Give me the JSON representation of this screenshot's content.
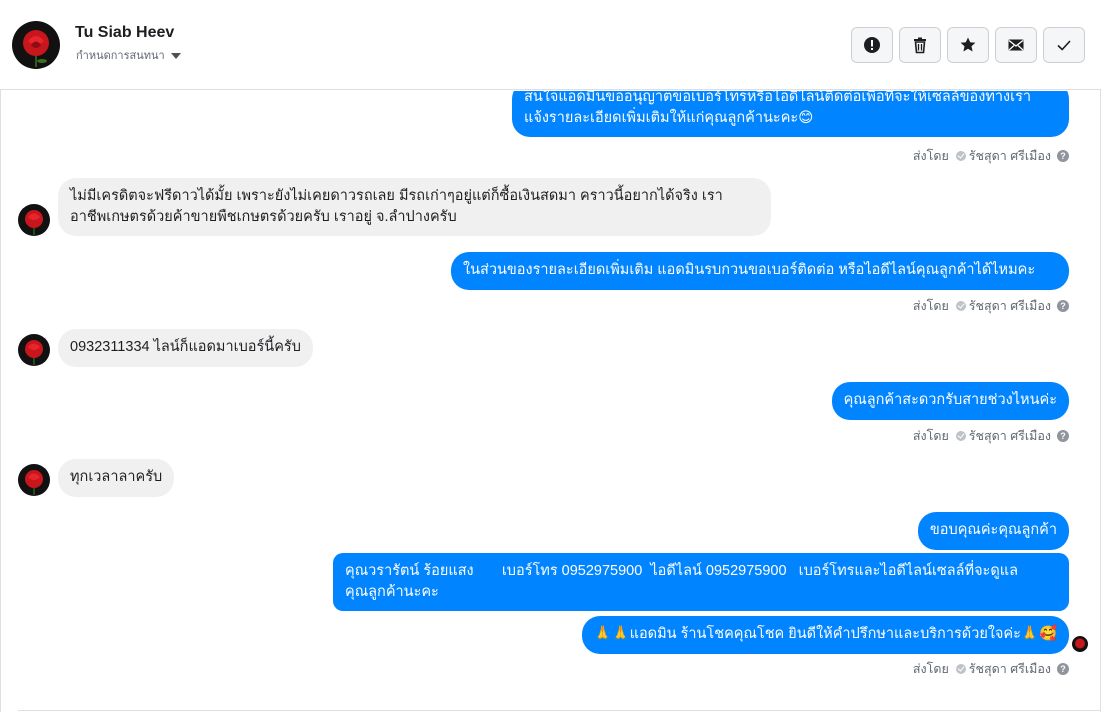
{
  "header": {
    "name": "Tu Siab Heev",
    "assign_label": "กำหนดการสนทนา"
  },
  "actions": [
    {
      "icon": "alert-icon",
      "label": "mark-spam"
    },
    {
      "icon": "trash-icon",
      "label": "delete"
    },
    {
      "icon": "star-icon",
      "label": "star"
    },
    {
      "icon": "mail-icon",
      "label": "mark-unread"
    },
    {
      "icon": "check-icon",
      "label": "mark-done"
    }
  ],
  "colors": {
    "outgoing": "#0084ff",
    "incoming": "#f1f0f0"
  },
  "messages": {
    "m1_line1": "สนใจแอดมินขออนุญาตขอเบอร์โทรหรือไอดีไลน์ติดต่อเพื่อที่จะให้เซลล์ของทางเรา",
    "m1_line2": "แจ้งรายละเอียดเพิ่มเติมให้แก่คุณลูกค้านะคะ😊",
    "m2_line1": "ไม่มีเครดิตจะฟรีดาวได้มั้ย เพราะยังไม่เคยดาวรถเลย มีรถเก่าๆอยู่แต่ก็ซื้อเงินสดมา คราวนี้อยากได้จริง เรา",
    "m2_line2": "อาชีพเกษตรด้วยค้าขายพืชเกษตรด้วยครับ เราอยู่ จ.ลำปางครับ",
    "m3": "ในส่วนของรายละเอียดเพิ่มเติม แอดมินรบกวนขอเบอร์ติดต่อ หรือไอดีไลน์คุณลูกค้าได้ไหมคะ",
    "m4": "0932311334 ไลน์ก็แอดมาเบอร์นี้ครับ",
    "m5": "คุณลูกค้าสะดวกรับสายช่วงไหนค่ะ",
    "m6": "ทุกเวลาลาครับ",
    "m7": "ขอบคุณค่ะคุณลูกค้า",
    "m8_line1": "คุณวรารัตน์ ร้อยแสง       เบอร์โทร 0952975900  ไอดีไลน์ 0952975900   เบอร์โทรและไอดีไลน์เซลล์ที่จะดูแล",
    "m8_line2": "คุณลูกค้านะคะ",
    "m9": "🙏🙏แอดมิน ร้านโชคคุณโชค ยินดีให้คำปรึกษาและบริการด้วยใจค่ะ🙏🥰"
  },
  "sent_by": {
    "prefix": "ส่งโดย",
    "agent": "รัชสุดา ศรีเมือง",
    "help": "?"
  }
}
